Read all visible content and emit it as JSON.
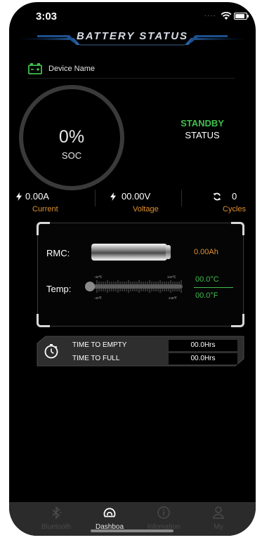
{
  "status_bar": {
    "time": "3:03"
  },
  "header": {
    "title": "BATTERY STATUS"
  },
  "device": {
    "name": "Device Name"
  },
  "soc": {
    "value": "0%",
    "label": "SOC"
  },
  "state": {
    "value": "STANDBY",
    "label": "STATUS"
  },
  "metrics": {
    "current": {
      "value": "0.00A",
      "label": "Current"
    },
    "voltage": {
      "value": "00.00V",
      "label": "Voltage"
    },
    "cycles": {
      "value": "0",
      "label": "Cycles"
    }
  },
  "rmc": {
    "label": "RMC:",
    "value": "0.00Ah"
  },
  "temp": {
    "label": "Temp:",
    "celsius": "00.0°C",
    "fahrenheit": "00.0°F",
    "scale_c_min": "-40℃",
    "scale_c_max": "120℃",
    "scale_f_min": "-40℉",
    "scale_f_max": "248℉"
  },
  "timing": {
    "to_empty": {
      "label": "TIME TO EMPTY",
      "value": "00.0Hrs"
    },
    "to_full": {
      "label": "TIME TO FULL",
      "value": "00.0Hrs"
    }
  },
  "tabs": [
    {
      "label": "Bluetooth",
      "icon": "bluetooth-icon",
      "active": false
    },
    {
      "label": "Dashboa",
      "icon": "dashboard-icon",
      "active": true
    },
    {
      "label": "Infomation",
      "icon": "info-icon",
      "active": false
    },
    {
      "label": "My",
      "icon": "user-icon",
      "active": false
    }
  ],
  "colors": {
    "accent_green": "#3fbf4e",
    "accent_orange": "#e0912f",
    "background": "#000000"
  }
}
